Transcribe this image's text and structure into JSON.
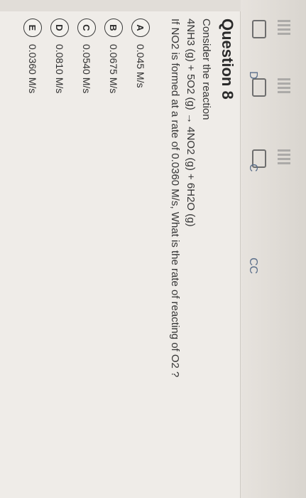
{
  "question": {
    "title": "Question 8",
    "intro": "Consider the reaction",
    "reaction": "4NH3 (g) + 5O2 (g) → 4NO2 (g) + 6H2O (g)",
    "prompt": "If NO2 is formed at a rate of 0.0360 M/s, What is the rate of reacting of O2 ?"
  },
  "options": [
    {
      "letter": "A",
      "text": "0.045 M/s"
    },
    {
      "letter": "B",
      "text": "0.0675 M/s"
    },
    {
      "letter": "C",
      "text": "0.0540 M/s"
    },
    {
      "letter": "D",
      "text": "0.0810 M/s"
    },
    {
      "letter": "E",
      "text": "0.0360 M/s"
    }
  ],
  "fragments": {
    "f1": "CC",
    "f2": "C",
    "f3": "D"
  }
}
